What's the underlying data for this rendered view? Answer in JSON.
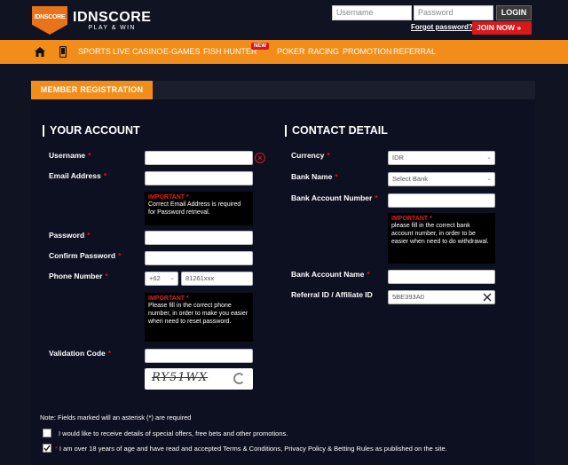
{
  "header": {
    "logo_shield_text": "IDNSCORE",
    "logo_name": "IDNSCORE",
    "logo_tagline": "PLAY & WIN",
    "username_placeholder": "Username",
    "password_placeholder": "Password",
    "login_label": "LOGIN",
    "forgot_label": "Forgot password?",
    "join_label": "JOIN NOW »"
  },
  "nav": {
    "items": [
      "SPORTS",
      "LIVE CASINO",
      "E-GAMES",
      "FISH HUNTER",
      "POKER",
      "RACING",
      "PROMOTION",
      "REFERRAL"
    ],
    "new_badge": "NEW"
  },
  "form": {
    "tab_label": "MEMBER REGISTRATION",
    "account_title": "YOUR ACCOUNT",
    "contact_title": "CONTACT DETAIL",
    "labels": {
      "username": "Username",
      "email": "Email Address",
      "password": "Password",
      "confirm_password": "Confirm Password",
      "phone": "Phone Number",
      "validation": "Validation Code",
      "currency": "Currency",
      "bank_name": "Bank Name",
      "bank_account_number": "Bank Account Number",
      "bank_account_name": "Bank Account Name",
      "referral": "Referral ID / Affiliate ID"
    },
    "required_mark": "*",
    "phone_prefix": "+62",
    "phone_placeholder": "81261xxx",
    "currency_value": "IDR",
    "bank_name_value": "Select Bank",
    "referral_value": "5BE393A0",
    "captcha_text": "RY51WX",
    "important_label": "IMPORTANT *",
    "notes": {
      "email": "Correct Email Address is required for Password retrieval.",
      "phone": "Please fill in the correct phone number, in order to make you easier when need to reset password.",
      "bank": "please fill in the correct bank account number, in order to be easier when need to do withdrawal."
    },
    "fields_note": "Note: Fields marked will an asterisk (*) are required",
    "promo_checkbox_label": "I would like to receive details of special offers, free bets and other promotions.",
    "terms_checkbox_label": "I am over 18 years of age and have read and accepted Terms & Conditions, Privacy Policy & Betting Rules as published on the site.",
    "terms_checked": true,
    "promo_checked": false
  },
  "colors": {
    "accent": "#f38d1a",
    "danger": "#d7191c",
    "background": "#0f1322"
  }
}
